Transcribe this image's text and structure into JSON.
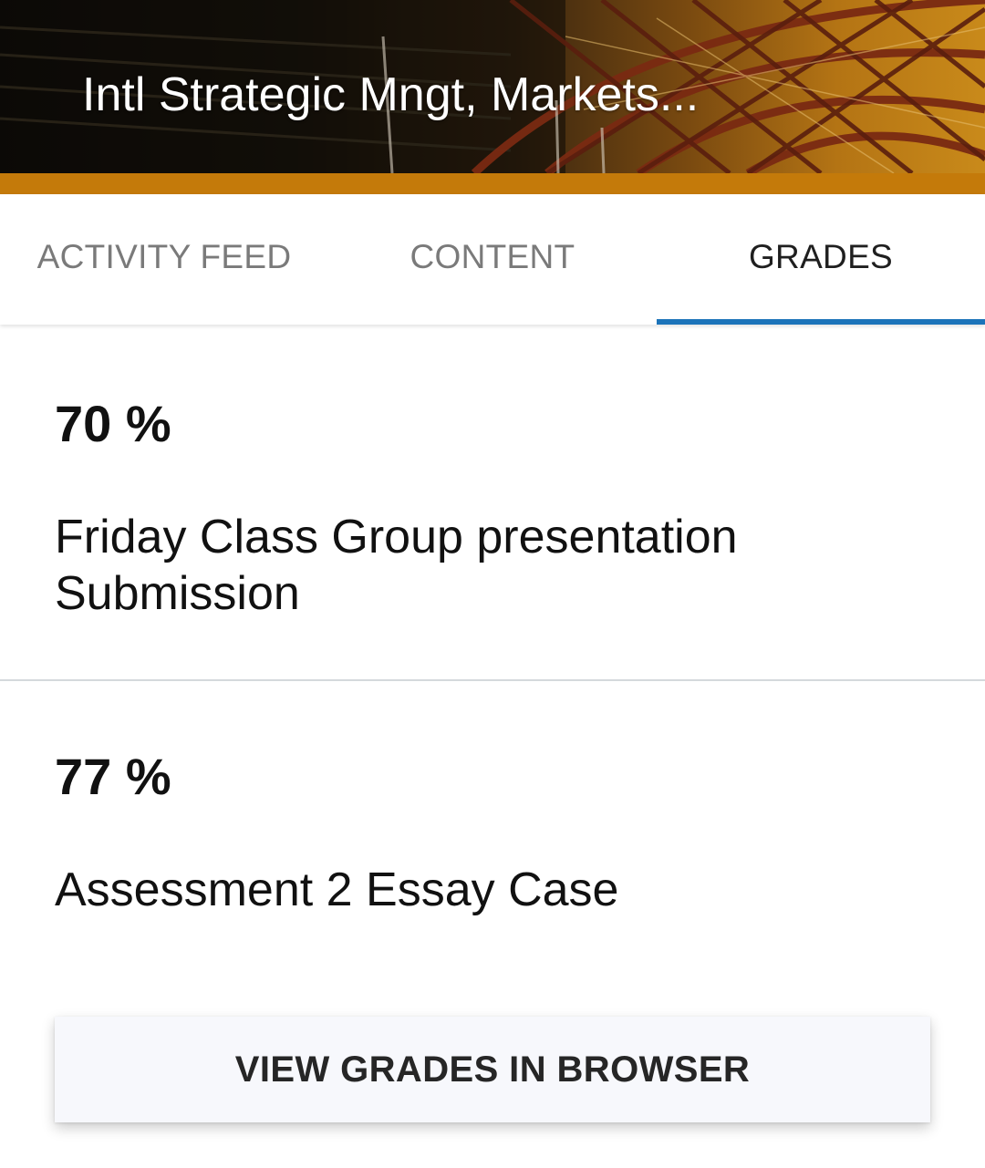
{
  "course": {
    "title": "Intl Strategic Mngt, Markets...",
    "banner_image": "stadium-roof-image"
  },
  "colors": {
    "accent": "#c47a0a",
    "tab_indicator": "#1b73b9",
    "divider": "#d4d9dc",
    "button_bg": "#f7f8fc"
  },
  "tabs": [
    {
      "label": "ACTIVITY FEED",
      "active": false
    },
    {
      "label": "CONTENT",
      "active": false
    },
    {
      "label": "GRADES",
      "active": true
    }
  ],
  "grades": [
    {
      "score": "70 %",
      "name": "Friday Class Group presentation Submission"
    },
    {
      "score": "77 %",
      "name": "Assessment 2 Essay Case"
    }
  ],
  "actions": {
    "view_grades_label": "VIEW GRADES IN BROWSER"
  }
}
